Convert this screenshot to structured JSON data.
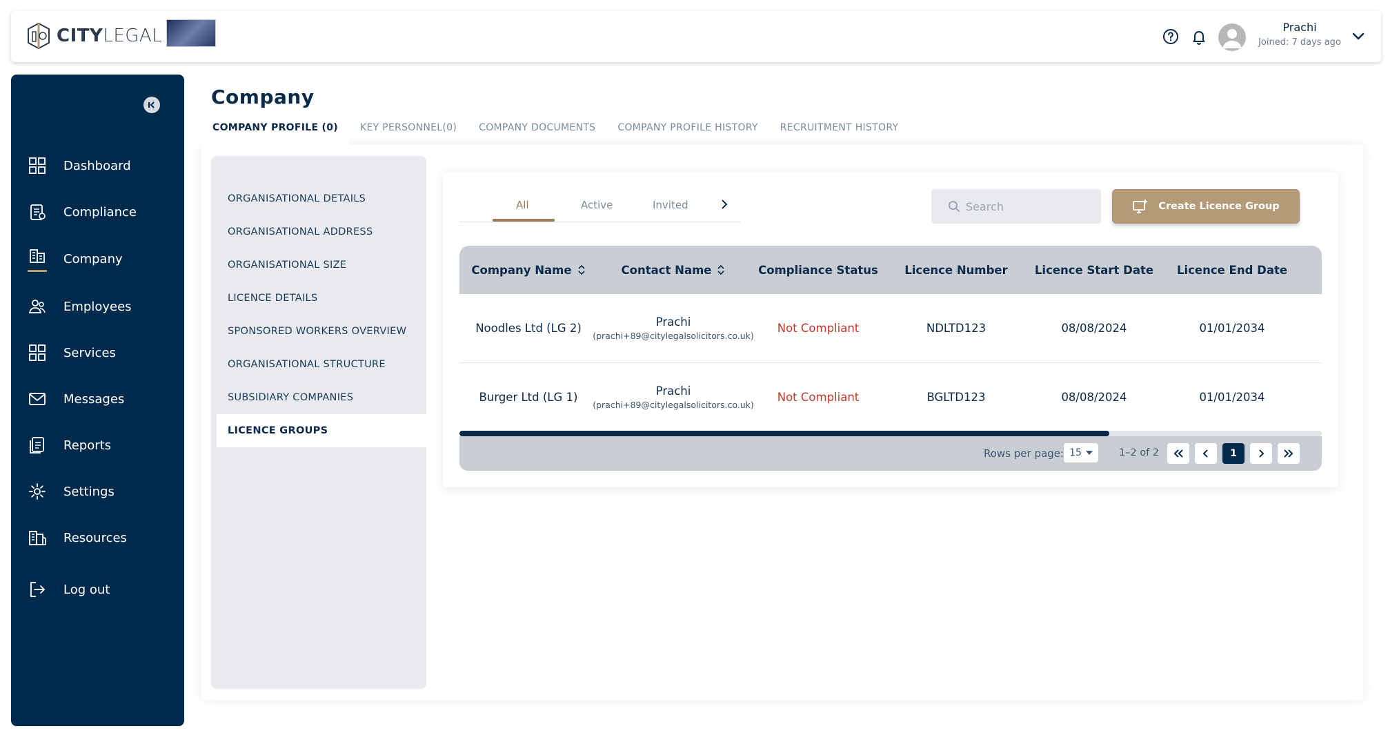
{
  "brand": {
    "name_bold": "CITY",
    "name_light": "LEGAL"
  },
  "user": {
    "name": "Prachi",
    "joined": "Joined: 7 days ago"
  },
  "sidebar": {
    "items": [
      {
        "label": "Dashboard",
        "icon": "dashboard-icon"
      },
      {
        "label": "Compliance",
        "icon": "compliance-icon"
      },
      {
        "label": "Company",
        "icon": "company-icon",
        "active": true
      },
      {
        "label": "Employees",
        "icon": "employees-icon"
      },
      {
        "label": "Services",
        "icon": "services-icon"
      },
      {
        "label": "Messages",
        "icon": "messages-icon"
      },
      {
        "label": "Reports",
        "icon": "reports-icon"
      },
      {
        "label": "Settings",
        "icon": "settings-icon"
      },
      {
        "label": "Resources",
        "icon": "resources-icon"
      },
      {
        "label": "Log out",
        "icon": "logout-icon"
      }
    ]
  },
  "page": {
    "title": "Company"
  },
  "tabs": [
    {
      "label": "COMPANY PROFILE (0)",
      "active": true
    },
    {
      "label": "KEY PERSONNEL(0)"
    },
    {
      "label": "COMPANY DOCUMENTS"
    },
    {
      "label": "COMPANY PROFILE HISTORY"
    },
    {
      "label": "RECRUITMENT HISTORY"
    }
  ],
  "subnav": [
    {
      "label": "ORGANISATIONAL DETAILS"
    },
    {
      "label": "ORGANISATIONAL ADDRESS"
    },
    {
      "label": "ORGANISATIONAL SIZE"
    },
    {
      "label": "LICENCE DETAILS"
    },
    {
      "label": "SPONSORED WORKERS OVERVIEW"
    },
    {
      "label": "ORGANISATIONAL STRUCTURE"
    },
    {
      "label": "SUBSIDIARY COMPANIES"
    },
    {
      "label": "LICENCE GROUPS",
      "active": true
    }
  ],
  "filters": [
    {
      "label": "All",
      "active": true
    },
    {
      "label": "Active"
    },
    {
      "label": "Invited"
    }
  ],
  "search": {
    "placeholder": "Search"
  },
  "create_button": {
    "label": "Create Licence Group"
  },
  "table": {
    "columns": [
      "Company Name",
      "Contact Name",
      "Compliance Status",
      "Licence Number",
      "Licence Start Date",
      "Licence End Date"
    ],
    "rows": [
      {
        "company": "Noodles Ltd (LG 2)",
        "contact_name": "Prachi",
        "contact_email": "(prachi+89@citylegalsolicitors.co.uk)",
        "status": "Not Compliant",
        "licence_number": "NDLTD123",
        "start": "08/08/2024",
        "end": "01/01/2034"
      },
      {
        "company": "Burger Ltd (LG 1)",
        "contact_name": "Prachi",
        "contact_email": "(prachi+89@citylegalsolicitors.co.uk)",
        "status": "Not Compliant",
        "licence_number": "BGLTD123",
        "start": "08/08/2024",
        "end": "01/01/2034"
      }
    ]
  },
  "pagination": {
    "rows_label": "Rows per page:",
    "rows_value": "15",
    "range": "1–2 of 2",
    "current_page": "1"
  },
  "colors": {
    "navy": "#002a4c",
    "accent": "#b59a78",
    "error": "#c0392b"
  }
}
